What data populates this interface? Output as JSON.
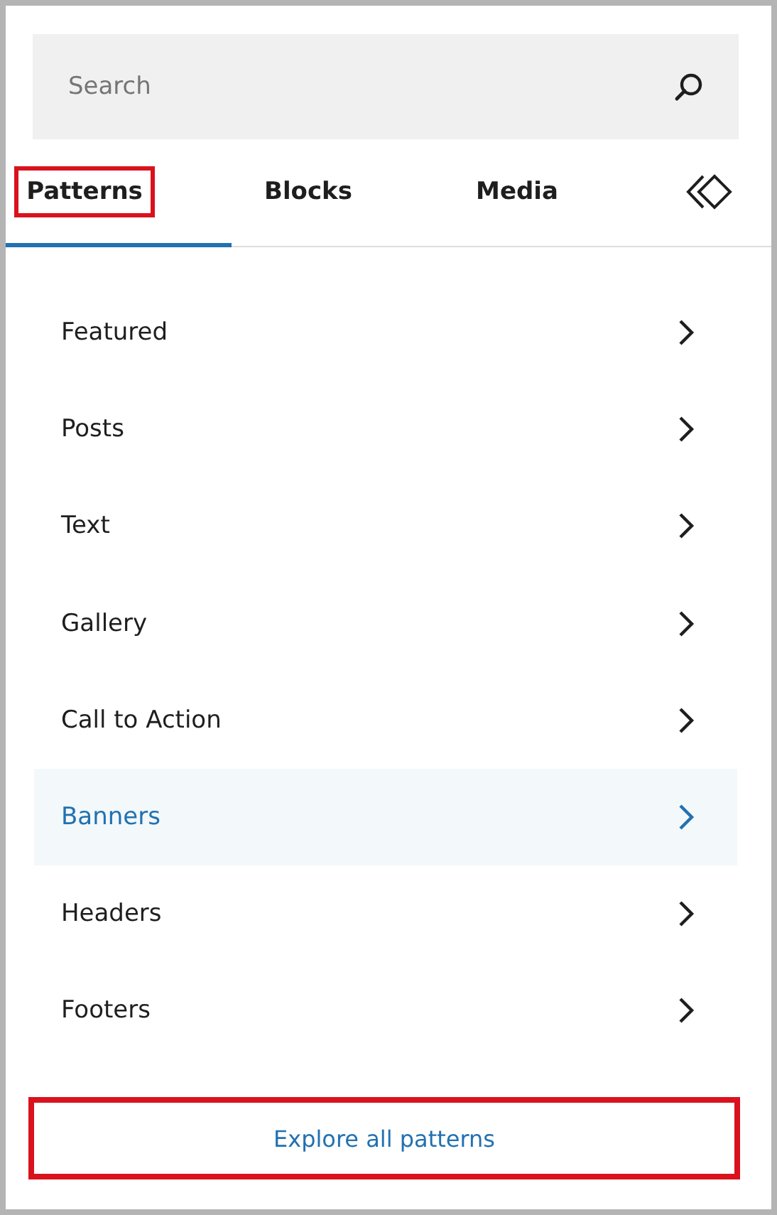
{
  "search": {
    "placeholder": "Search"
  },
  "tabs": [
    {
      "kind": "text",
      "label": "Patterns",
      "selected": true,
      "highlighted": true
    },
    {
      "kind": "text",
      "label": "Blocks",
      "selected": false,
      "highlighted": false
    },
    {
      "kind": "text",
      "label": "Media",
      "selected": false,
      "highlighted": false
    },
    {
      "kind": "icon",
      "selected": false,
      "highlighted": false
    }
  ],
  "categories": [
    {
      "label": "Featured",
      "selected": false
    },
    {
      "label": "Posts",
      "selected": false
    },
    {
      "label": "Text",
      "selected": false
    },
    {
      "label": "Gallery",
      "selected": false
    },
    {
      "label": "Call to Action",
      "selected": false
    },
    {
      "label": "Banners",
      "selected": true
    },
    {
      "label": "Headers",
      "selected": false
    },
    {
      "label": "Footers",
      "selected": false
    }
  ],
  "explore_button": {
    "label": "Explore all patterns",
    "highlighted": true
  }
}
